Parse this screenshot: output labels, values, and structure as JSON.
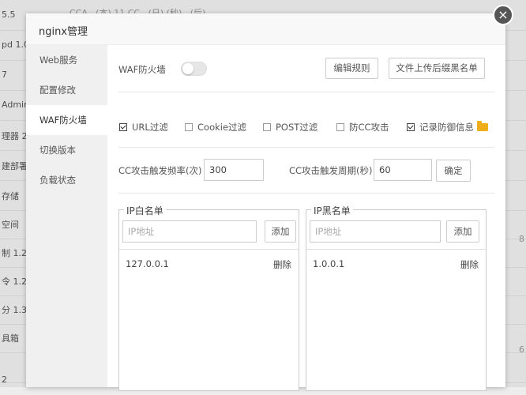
{
  "background": {
    "top_text": "CCA...(本)  11 CC...(日)  (秒)...(后)...",
    "rows": [
      "5.5",
      "pd 1.0",
      "7",
      "Admin",
      "理器 2.",
      "建部署",
      "存储",
      "空间",
      "制 1.2",
      "令 1.2",
      "分 1.3",
      "具箱",
      "",
      "2"
    ],
    "right_marks": [
      "8",
      "6"
    ]
  },
  "dialog": {
    "title": "nginx管理",
    "close_label": "×"
  },
  "sidebar": {
    "items": [
      {
        "label": "Web服务"
      },
      {
        "label": "配置修改"
      },
      {
        "label": "WAF防火墙"
      },
      {
        "label": "切换版本"
      },
      {
        "label": "负载状态"
      }
    ]
  },
  "waf": {
    "label": "WAF防火墙",
    "enabled": false,
    "edit_rules_label": "编辑规则",
    "upload_blacklist_label": "文件上传后缀黑名单"
  },
  "filters": [
    {
      "label": "URL过滤",
      "checked": true
    },
    {
      "label": "Cookie过滤",
      "checked": false
    },
    {
      "label": "POST过滤",
      "checked": false
    },
    {
      "label": "防CC攻击",
      "checked": false
    },
    {
      "label": "记录防御信息",
      "checked": true
    }
  ],
  "cc": {
    "freq_label": "CC攻击触发频率(次)",
    "freq_value": "300",
    "period_label": "CC攻击触发周期(秒)",
    "period_value": "60",
    "confirm_label": "确定"
  },
  "whitelist": {
    "title": "IP白名单",
    "placeholder": "IP地址",
    "add_label": "添加",
    "entries": [
      {
        "ip": "127.0.0.1",
        "delete_label": "删除"
      }
    ]
  },
  "blacklist": {
    "title": "IP黑名单",
    "placeholder": "IP地址",
    "add_label": "添加",
    "entries": [
      {
        "ip": "1.0.0.1",
        "delete_label": "删除"
      }
    ]
  },
  "colors": {
    "folder_icon": "#f0ad1a",
    "toggle_off": "#e6e6e6"
  }
}
